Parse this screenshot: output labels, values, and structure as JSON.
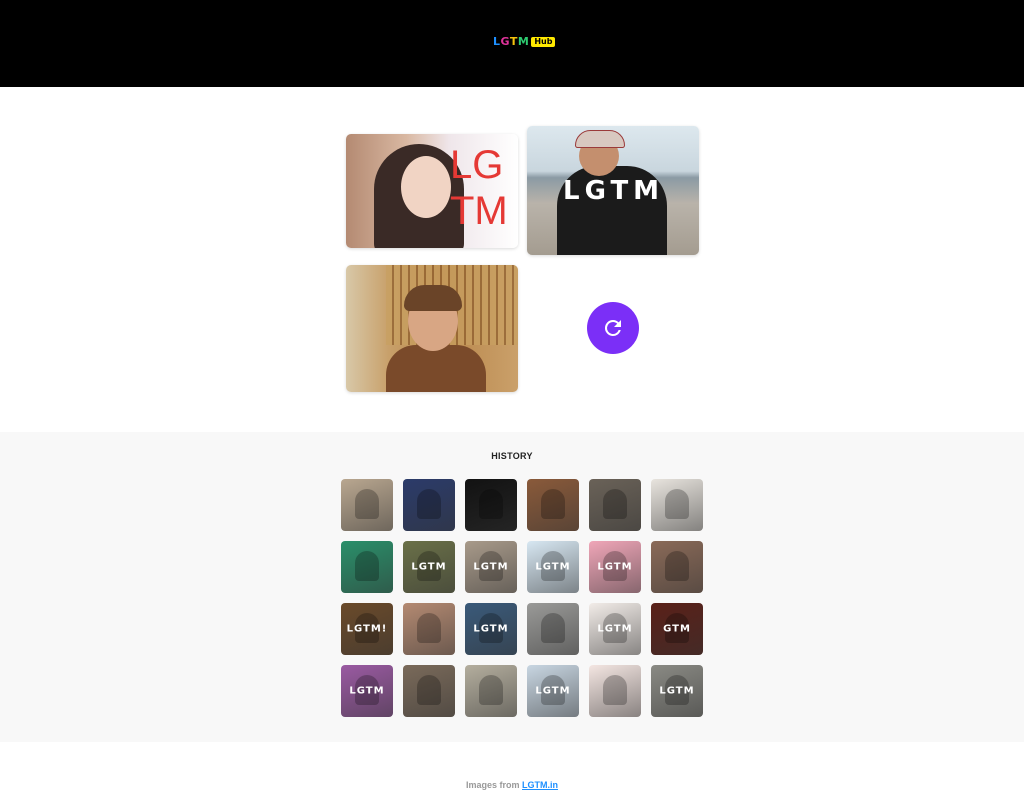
{
  "header": {
    "logo_letters": [
      "L",
      "G",
      "T",
      "M"
    ],
    "logo_badge": "Hub"
  },
  "main": {
    "cards": [
      {
        "caption": "LG\nTM",
        "color": "#e53935"
      },
      {
        "caption": "LGTM",
        "color": "#ffffff"
      },
      {
        "caption": "",
        "color": "#ffffff"
      }
    ],
    "refresh_icon": "refresh-icon"
  },
  "history": {
    "title": "HISTORY",
    "thumbs": [
      {
        "caption": "",
        "bg": "#b9a790"
      },
      {
        "caption": "",
        "bg": "#2b3b6a"
      },
      {
        "caption": "",
        "bg": "#121212"
      },
      {
        "caption": "",
        "bg": "#8a5a3a"
      },
      {
        "caption": "",
        "bg": "#6a6258"
      },
      {
        "caption": "",
        "bg": "#e8e4de"
      },
      {
        "caption": "",
        "bg": "#2a8f6a"
      },
      {
        "caption": "LGTM",
        "bg": "#6a7048"
      },
      {
        "caption": "LGTM",
        "bg": "#a89a8a"
      },
      {
        "caption": "LGTM",
        "bg": "#d7e7f2"
      },
      {
        "caption": "LGTM",
        "bg": "#f0a6b8"
      },
      {
        "caption": "",
        "bg": "#8a6a58"
      },
      {
        "caption": "LGTM!",
        "bg": "#6a4a2a"
      },
      {
        "caption": "",
        "bg": "#b48a72"
      },
      {
        "caption": "LGTM",
        "bg": "#3a5a7a"
      },
      {
        "caption": "",
        "bg": "#9a9a98"
      },
      {
        "caption": "LGTM",
        "bg": "#f2ece8"
      },
      {
        "caption": "GTM",
        "bg": "#5a2018"
      },
      {
        "caption": "LGTM",
        "bg": "#9a5aa2"
      },
      {
        "caption": "",
        "bg": "#7a6a5a"
      },
      {
        "caption": "",
        "bg": "#b4ae9e"
      },
      {
        "caption": "LGTM",
        "bg": "#c8d6e2"
      },
      {
        "caption": "",
        "bg": "#f4e6e2"
      },
      {
        "caption": "LGTM",
        "bg": "#8a8a84"
      }
    ]
  },
  "footer": {
    "prefix": "Images from ",
    "link_text": "LGTM.in"
  }
}
